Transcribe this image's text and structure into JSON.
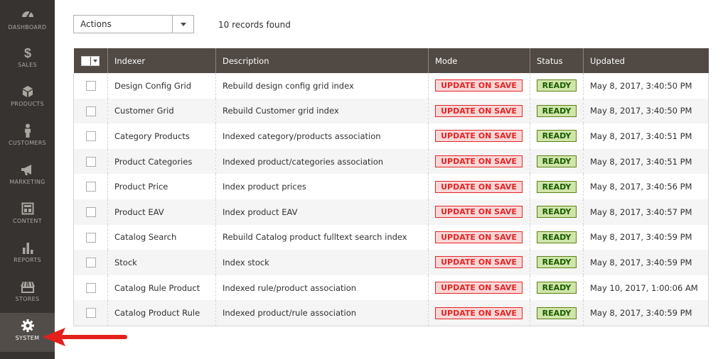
{
  "sidebar": {
    "items": [
      {
        "label": "DASHBOARD",
        "icon": "dashboard-icon"
      },
      {
        "label": "SALES",
        "icon": "dollar-icon"
      },
      {
        "label": "PRODUCTS",
        "icon": "cube-icon"
      },
      {
        "label": "CUSTOMERS",
        "icon": "person-icon"
      },
      {
        "label": "MARKETING",
        "icon": "megaphone-icon"
      },
      {
        "label": "CONTENT",
        "icon": "layout-icon"
      },
      {
        "label": "REPORTS",
        "icon": "bar-chart-icon"
      },
      {
        "label": "STORES",
        "icon": "storefront-icon"
      },
      {
        "label": "SYSTEM",
        "icon": "gear-icon",
        "active": true
      }
    ]
  },
  "toolbar": {
    "actions_label": "Actions",
    "records_found": "10 records found"
  },
  "grid": {
    "columns": [
      "Indexer",
      "Description",
      "Mode",
      "Status",
      "Updated"
    ],
    "rows": [
      {
        "indexer": "Design Config Grid",
        "description": "Rebuild design config grid index",
        "mode": "UPDATE ON SAVE",
        "status": "READY",
        "updated": "May 8, 2017, 3:40:50 PM"
      },
      {
        "indexer": "Customer Grid",
        "description": "Rebuild Customer grid index",
        "mode": "UPDATE ON SAVE",
        "status": "READY",
        "updated": "May 8, 2017, 3:40:50 PM"
      },
      {
        "indexer": "Category Products",
        "description": "Indexed category/products association",
        "mode": "UPDATE ON SAVE",
        "status": "READY",
        "updated": "May 8, 2017, 3:40:51 PM"
      },
      {
        "indexer": "Product Categories",
        "description": "Indexed product/categories association",
        "mode": "UPDATE ON SAVE",
        "status": "READY",
        "updated": "May 8, 2017, 3:40:51 PM"
      },
      {
        "indexer": "Product Price",
        "description": "Index product prices",
        "mode": "UPDATE ON SAVE",
        "status": "READY",
        "updated": "May 8, 2017, 3:40:56 PM"
      },
      {
        "indexer": "Product EAV",
        "description": "Index product EAV",
        "mode": "UPDATE ON SAVE",
        "status": "READY",
        "updated": "May 8, 2017, 3:40:57 PM"
      },
      {
        "indexer": "Catalog Search",
        "description": "Rebuild Catalog product fulltext search index",
        "mode": "UPDATE ON SAVE",
        "status": "READY",
        "updated": "May 8, 2017, 3:40:59 PM"
      },
      {
        "indexer": "Stock",
        "description": "Index stock",
        "mode": "UPDATE ON SAVE",
        "status": "READY",
        "updated": "May 8, 2017, 3:40:59 PM"
      },
      {
        "indexer": "Catalog Rule Product",
        "description": "Indexed rule/product association",
        "mode": "UPDATE ON SAVE",
        "status": "READY",
        "updated": "May 10, 2017, 1:00:06 AM"
      },
      {
        "indexer": "Catalog Product Rule",
        "description": "Indexed product/rule association",
        "mode": "UPDATE ON SAVE",
        "status": "READY",
        "updated": "May 8, 2017, 3:40:59 PM"
      }
    ]
  },
  "colors": {
    "sidebar_bg": "#373330",
    "header_bg": "#514943",
    "mode_badge": "#e22626",
    "status_badge": "#185b00",
    "annotation_arrow": "#e3201b"
  }
}
